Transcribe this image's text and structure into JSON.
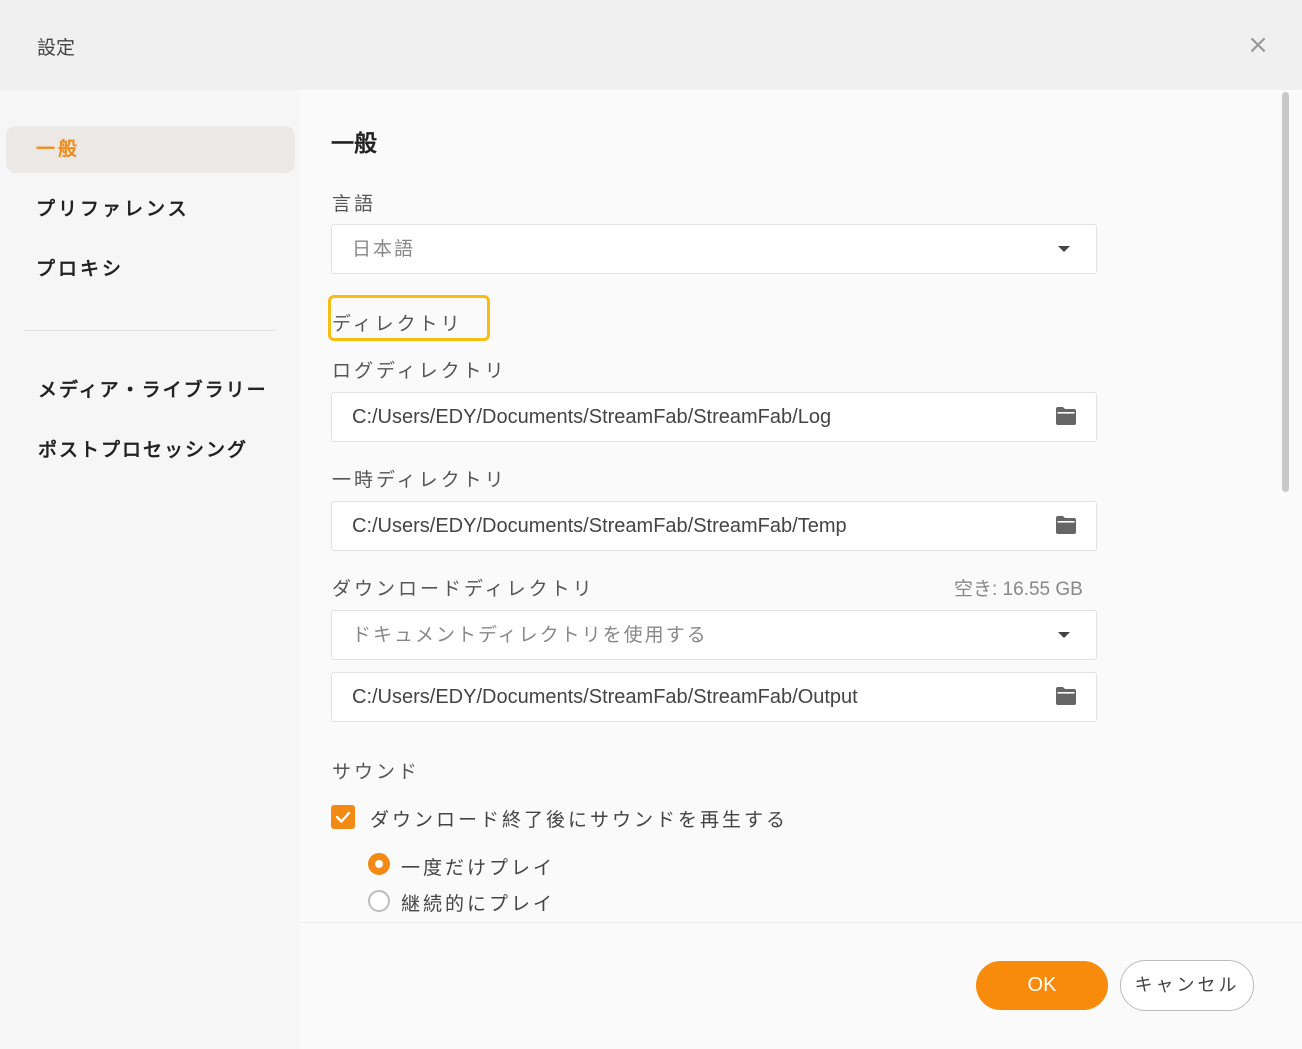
{
  "window": {
    "title": "設定",
    "close_glyph": "×"
  },
  "sidebar": {
    "items": [
      {
        "label": "一般",
        "active": true
      },
      {
        "label": "プリファレンス"
      },
      {
        "label": "プロキシ"
      },
      {
        "label": "メディア・ライブラリー"
      },
      {
        "label": "ポストプロセッシング"
      }
    ]
  },
  "main": {
    "heading": "一般",
    "language": {
      "label": "言語",
      "value": "日本語"
    },
    "directory_section": "ディレクトリ",
    "log_dir": {
      "label": "ログディレクトリ",
      "value": "C:/Users/EDY/Documents/StreamFab/StreamFab/Log"
    },
    "temp_dir": {
      "label": "一時ディレクトリ",
      "value": "C:/Users/EDY/Documents/StreamFab/StreamFab/Temp"
    },
    "download_dir": {
      "label": "ダウンロードディレクトリ",
      "free_space": "空き: 16.55 GB",
      "mode": "ドキュメントディレクトリを使用する",
      "value": "C:/Users/EDY/Documents/StreamFab/StreamFab/Output"
    },
    "sound": {
      "label": "サウンド",
      "checkbox_label": "ダウンロード終了後にサウンドを再生する",
      "checked": true,
      "options": [
        {
          "label": "一度だけプレイ",
          "selected": true
        },
        {
          "label": "継続的にプレイ",
          "selected": false
        }
      ]
    }
  },
  "footer": {
    "ok": "OK",
    "cancel": "キャンセル"
  },
  "colors": {
    "accent": "#f38a16",
    "highlight": "#f8bd12"
  },
  "icons": {
    "folder": "folder-icon",
    "dropdown": "chevron-down-icon",
    "check": "check-icon"
  }
}
